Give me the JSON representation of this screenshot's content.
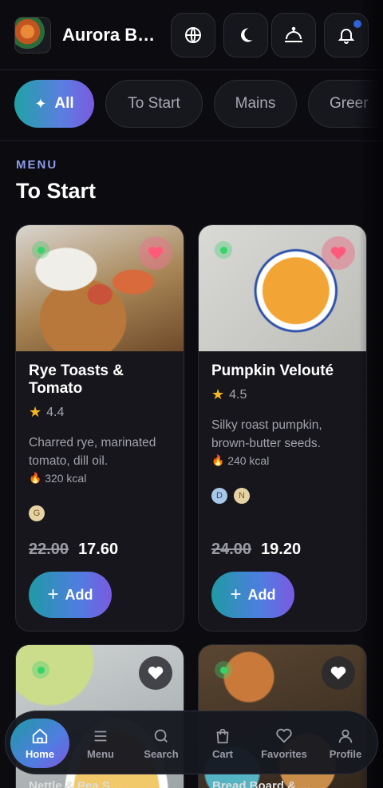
{
  "header": {
    "brand": "Aurora Bi…",
    "icons": [
      "globe-icon",
      "moon-icon",
      "cloche-icon",
      "bell-icon"
    ]
  },
  "filters": [
    {
      "label": "All",
      "active": true
    },
    {
      "label": "To Start",
      "active": false
    },
    {
      "label": "Mains",
      "active": false
    },
    {
      "label": "Greer",
      "active": false
    }
  ],
  "section": {
    "eyebrow": "MENU",
    "title": "To Start"
  },
  "cards": [
    {
      "title_line1": "Rye Toasts &",
      "title_line2": "Tomato",
      "rating": "4.4",
      "desc_line1": "Charred rye, marinated",
      "desc_line2": "tomato, dill oil.",
      "kcal": "320 kcal",
      "old_price": "22.00",
      "new_price": "17.60",
      "add_label": "Add"
    },
    {
      "title_line1": "Pumpkin Velouté",
      "rating": "4.5",
      "desc_line1": "Silky roast pumpkin,",
      "desc_line2": "brown-butter seeds.",
      "kcal": "240 kcal",
      "old_price": "24.00",
      "new_price": "19.20",
      "add_label": "Add"
    }
  ],
  "bottom_cards": [
    {
      "partial_title": "Nettle & Pea S…"
    },
    {
      "partial_title": "Bread Board & …"
    }
  ],
  "nav": {
    "home": "Home",
    "menu": "Menu",
    "search": "Search",
    "cart": "Cart",
    "favorites": "Favorites",
    "profile": "Profile"
  },
  "colors": {
    "accent_start": "#1f9aa5",
    "accent_end": "#7b5ae0",
    "eyebrow": "#8c9be8",
    "background": "#0b0b10"
  }
}
